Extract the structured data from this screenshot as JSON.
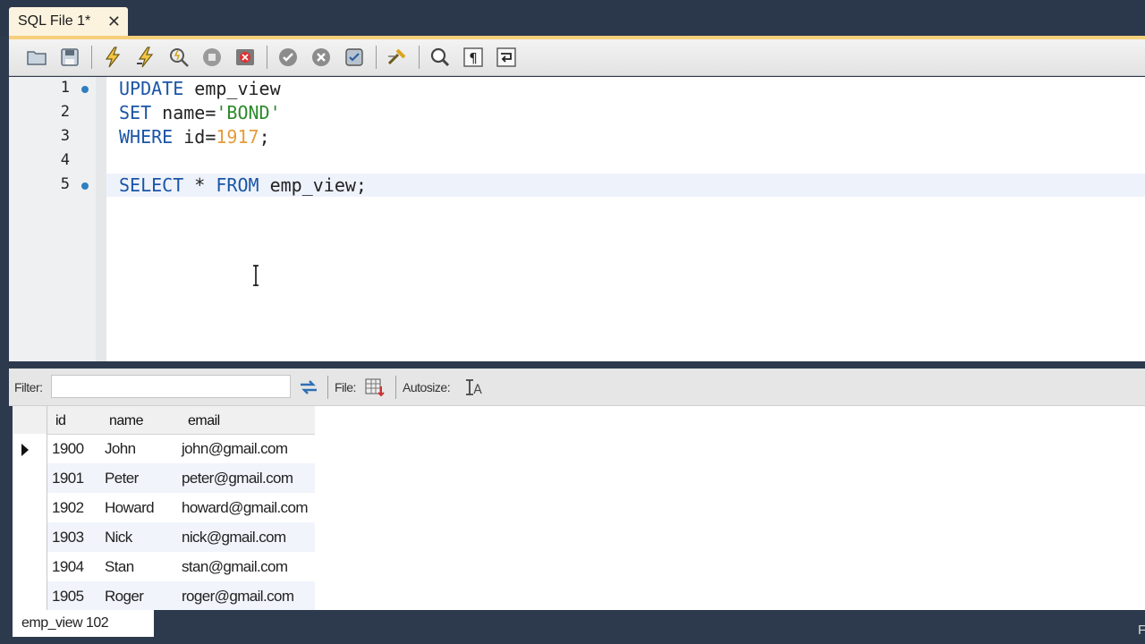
{
  "tab": {
    "title": "SQL File 1*",
    "close_glyph": "✕"
  },
  "toolbar": {
    "buttons": [
      "open-file-icon",
      "save-icon",
      "execute-icon",
      "execute-current-icon",
      "explain-icon",
      "stop-icon",
      "toggle-error-icon",
      "commit-icon",
      "rollback-icon",
      "autocommit-icon",
      "beautify-icon",
      "find-icon",
      "invisibles-icon",
      "wrap-icon"
    ]
  },
  "editor": {
    "line_numbers": [
      "1",
      "2",
      "3",
      "4",
      "5"
    ],
    "lines": [
      [
        {
          "t": "UPDATE",
          "c": "kw"
        },
        {
          "t": " emp_view",
          "c": ""
        }
      ],
      [
        {
          "t": "SET",
          "c": "kw"
        },
        {
          "t": " name=",
          "c": ""
        },
        {
          "t": "'BOND'",
          "c": "str"
        }
      ],
      [
        {
          "t": "WHERE",
          "c": "kw"
        },
        {
          "t": " id=",
          "c": ""
        },
        {
          "t": "1917",
          "c": "num"
        },
        {
          "t": ";",
          "c": ""
        }
      ],
      [],
      [
        {
          "t": "SELECT",
          "c": "kw"
        },
        {
          "t": " * ",
          "c": ""
        },
        {
          "t": "FROM",
          "c": "kw"
        },
        {
          "t": " emp_view;",
          "c": ""
        }
      ]
    ],
    "statement_dot_lines": [
      1,
      5
    ],
    "current_line": 5
  },
  "result_toolbar": {
    "filter_label": "Filter:",
    "filter_value": "",
    "file_label": "File:",
    "autosize_label": "Autosize:"
  },
  "grid": {
    "columns": [
      "id",
      "name",
      "email"
    ],
    "rows": [
      [
        "1900",
        "John",
        "john@gmail.com"
      ],
      [
        "1901",
        "Peter",
        "peter@gmail.com"
      ],
      [
        "1902",
        "Howard",
        "howard@gmail.com"
      ],
      [
        "1903",
        "Nick",
        "nick@gmail.com"
      ],
      [
        "1904",
        "Stan",
        "stan@gmail.com"
      ],
      [
        "1905",
        "Roger",
        "roger@gmail.com"
      ]
    ]
  },
  "result_tab": {
    "label": "emp_view 102"
  },
  "edge_text": "F",
  "colors": {
    "keyword": "#1b55a6",
    "string": "#2a8a2a",
    "number": "#e49b3a",
    "accent": "#f6cf7b",
    "chrome_dark": "#2d3a4e"
  }
}
